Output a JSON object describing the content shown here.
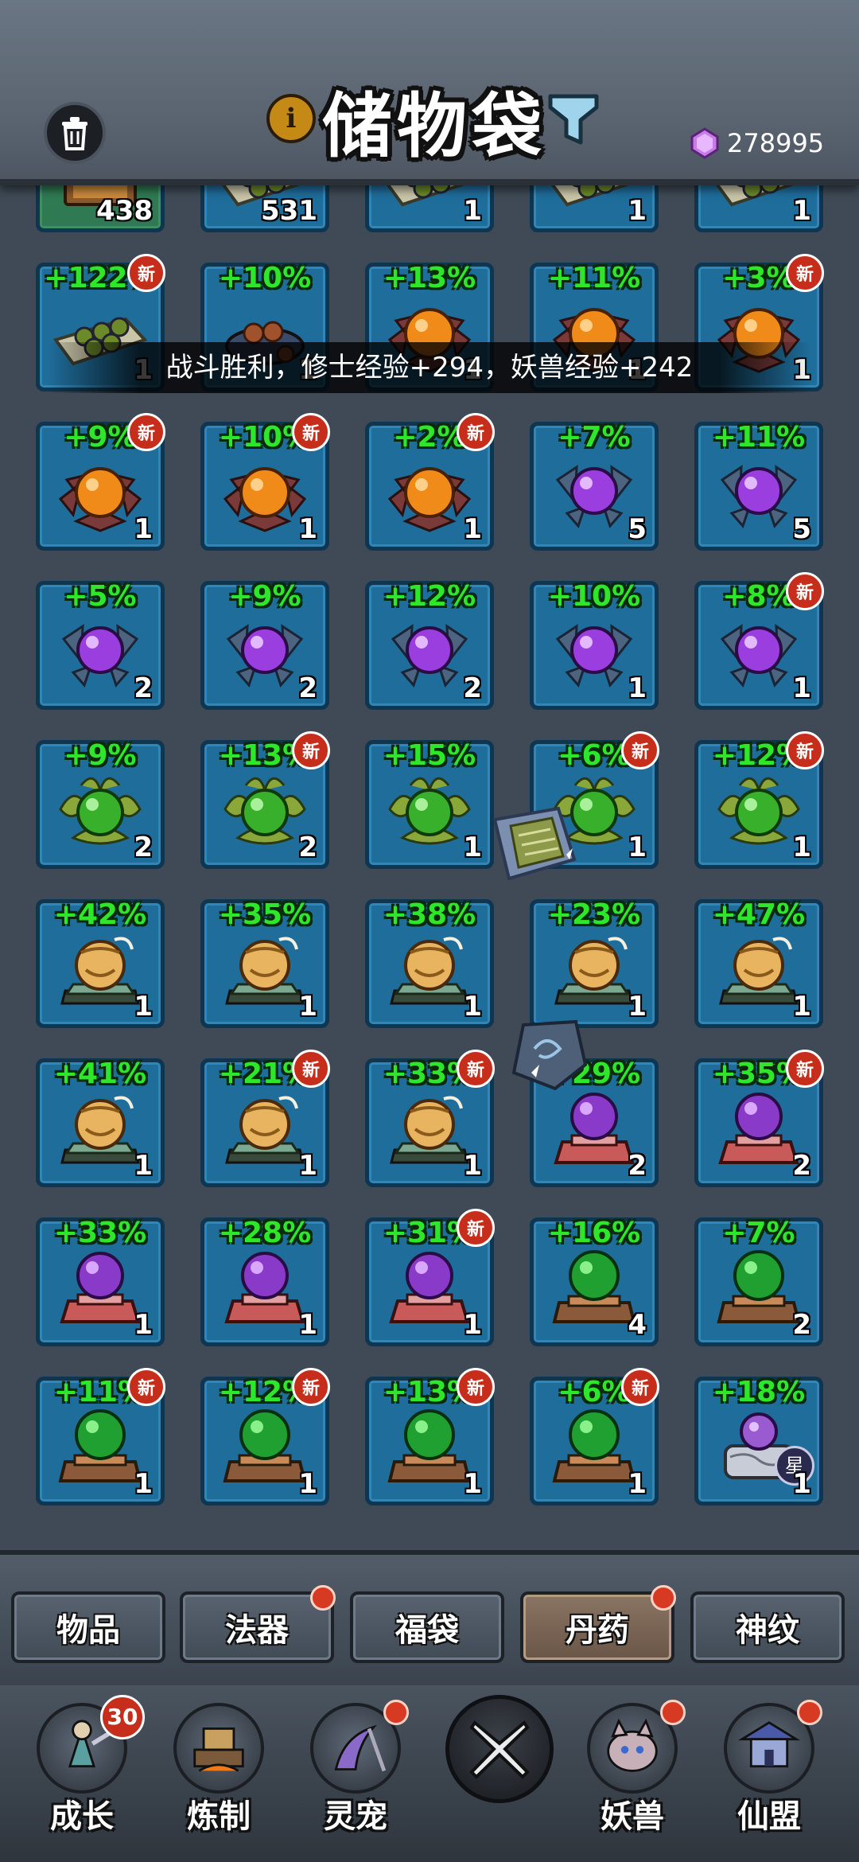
{
  "header": {
    "title": "储物袋",
    "info_label": "i",
    "currency": {
      "icon": "purple-gem-icon",
      "value": "278995"
    }
  },
  "toast": "战斗胜利，修士经验+294，妖兽经验+242",
  "grid": {
    "rows": [
      [
        {
          "icon": "red-orb-chest",
          "count": "438",
          "bonus": "",
          "is_new": false,
          "selected": true
        },
        {
          "icon": "green-beads-scroll",
          "count": "531",
          "bonus": "",
          "is_new": false
        },
        {
          "icon": "green-beads-scroll",
          "count": "1",
          "bonus": "",
          "is_new": false
        },
        {
          "icon": "green-beads-scroll",
          "count": "1",
          "bonus": "",
          "is_new": false
        },
        {
          "icon": "green-beads-scroll",
          "count": "1",
          "bonus": "",
          "is_new": false
        }
      ],
      [
        {
          "icon": "green-beads-scroll",
          "count": "1",
          "bonus": "+122%",
          "is_new": true
        },
        {
          "icon": "pill-bowl",
          "count": "1",
          "bonus": "+10%",
          "is_new": false
        },
        {
          "icon": "orange-lotus-pill",
          "count": "1",
          "bonus": "+13%",
          "is_new": false
        },
        {
          "icon": "orange-lotus-pill",
          "count": "1",
          "bonus": "+11%",
          "is_new": false
        },
        {
          "icon": "orange-lotus-pill",
          "count": "1",
          "bonus": "+3%",
          "is_new": true
        }
      ],
      [
        {
          "icon": "orange-lotus-pill",
          "count": "1",
          "bonus": "+9%",
          "is_new": true
        },
        {
          "icon": "orange-lotus-pill",
          "count": "1",
          "bonus": "+10%",
          "is_new": true
        },
        {
          "icon": "orange-lotus-pill",
          "count": "1",
          "bonus": "+2%",
          "is_new": true
        },
        {
          "icon": "purple-crystal-pill",
          "count": "5",
          "bonus": "+7%",
          "is_new": false
        },
        {
          "icon": "purple-crystal-pill",
          "count": "5",
          "bonus": "+11%",
          "is_new": false
        }
      ],
      [
        {
          "icon": "purple-crystal-pill",
          "count": "2",
          "bonus": "+5%",
          "is_new": false
        },
        {
          "icon": "purple-crystal-pill",
          "count": "2",
          "bonus": "+9%",
          "is_new": false
        },
        {
          "icon": "purple-crystal-pill",
          "count": "2",
          "bonus": "+12%",
          "is_new": false
        },
        {
          "icon": "purple-crystal-pill",
          "count": "1",
          "bonus": "+10%",
          "is_new": false
        },
        {
          "icon": "purple-crystal-pill",
          "count": "1",
          "bonus": "+8%",
          "is_new": true
        }
      ],
      [
        {
          "icon": "green-leaf-pill",
          "count": "2",
          "bonus": "+9%",
          "is_new": false
        },
        {
          "icon": "green-leaf-pill",
          "count": "2",
          "bonus": "+13%",
          "is_new": true
        },
        {
          "icon": "green-leaf-pill",
          "count": "1",
          "bonus": "+15%",
          "is_new": false
        },
        {
          "icon": "green-leaf-pill",
          "count": "1",
          "bonus": "+6%",
          "is_new": true
        },
        {
          "icon": "green-leaf-pill",
          "count": "1",
          "bonus": "+12%",
          "is_new": true
        }
      ],
      [
        {
          "icon": "golden-beast-pill",
          "count": "1",
          "bonus": "+42%",
          "is_new": false
        },
        {
          "icon": "golden-beast-pill",
          "count": "1",
          "bonus": "+35%",
          "is_new": false
        },
        {
          "icon": "golden-beast-pill",
          "count": "1",
          "bonus": "+38%",
          "is_new": false
        },
        {
          "icon": "golden-beast-pill",
          "count": "1",
          "bonus": "+23%",
          "is_new": false
        },
        {
          "icon": "golden-beast-pill",
          "count": "1",
          "bonus": "+47%",
          "is_new": false
        }
      ],
      [
        {
          "icon": "golden-beast-pill",
          "count": "1",
          "bonus": "+41%",
          "is_new": false
        },
        {
          "icon": "golden-beast-pill",
          "count": "1",
          "bonus": "+21%",
          "is_new": true
        },
        {
          "icon": "golden-beast-pill",
          "count": "1",
          "bonus": "+33%",
          "is_new": true
        },
        {
          "icon": "purple-orb-altar",
          "count": "2",
          "bonus": "+29%",
          "is_new": false
        },
        {
          "icon": "purple-orb-altar",
          "count": "2",
          "bonus": "+35%",
          "is_new": true
        }
      ],
      [
        {
          "icon": "purple-orb-altar",
          "count": "1",
          "bonus": "+33%",
          "is_new": false
        },
        {
          "icon": "purple-orb-altar",
          "count": "1",
          "bonus": "+28%",
          "is_new": false
        },
        {
          "icon": "purple-orb-altar",
          "count": "1",
          "bonus": "+31%",
          "is_new": true
        },
        {
          "icon": "green-orb-altar",
          "count": "4",
          "bonus": "+16%",
          "is_new": false
        },
        {
          "icon": "green-orb-altar",
          "count": "2",
          "bonus": "+7%",
          "is_new": false
        }
      ],
      [
        {
          "icon": "green-orb-altar",
          "count": "1",
          "bonus": "+11%",
          "is_new": true
        },
        {
          "icon": "green-orb-altar",
          "count": "1",
          "bonus": "+12%",
          "is_new": true
        },
        {
          "icon": "green-orb-altar",
          "count": "1",
          "bonus": "+13%",
          "is_new": true
        },
        {
          "icon": "green-orb-altar",
          "count": "1",
          "bonus": "+6%",
          "is_new": true
        },
        {
          "icon": "star-purple-pot",
          "count": "1",
          "bonus": "+18%",
          "is_new": false,
          "star": "星"
        }
      ]
    ],
    "new_label": "新"
  },
  "floating_items": [
    {
      "icon": "green-scroll-drop-icon"
    },
    {
      "icon": "rune-stone-drop-icon"
    }
  ],
  "tabs": [
    {
      "label": "物品",
      "active": false,
      "dot": false
    },
    {
      "label": "法器",
      "active": false,
      "dot": true
    },
    {
      "label": "福袋",
      "active": false,
      "dot": false
    },
    {
      "label": "丹药",
      "active": true,
      "dot": true
    },
    {
      "label": "神纹",
      "active": false,
      "dot": false
    }
  ],
  "nav": [
    {
      "label": "成长",
      "icon": "growth-warrior-icon",
      "badge": "30"
    },
    {
      "label": "炼制",
      "icon": "forge-anvil-icon",
      "dot": false
    },
    {
      "label": "灵宠",
      "icon": "spirit-pet-scythe-icon",
      "dot": true
    },
    {
      "label": "妖兽",
      "icon": "demon-beast-icon",
      "dot": true
    },
    {
      "label": "仙盟",
      "icon": "immortal-alliance-pavilion-icon",
      "dot": true
    }
  ],
  "colors": {
    "cell_bg": "#1f6d9b",
    "bonus_green": "#2ee62a",
    "new_badge_red": "#c62d1b",
    "active_tab": "#8a7463"
  }
}
